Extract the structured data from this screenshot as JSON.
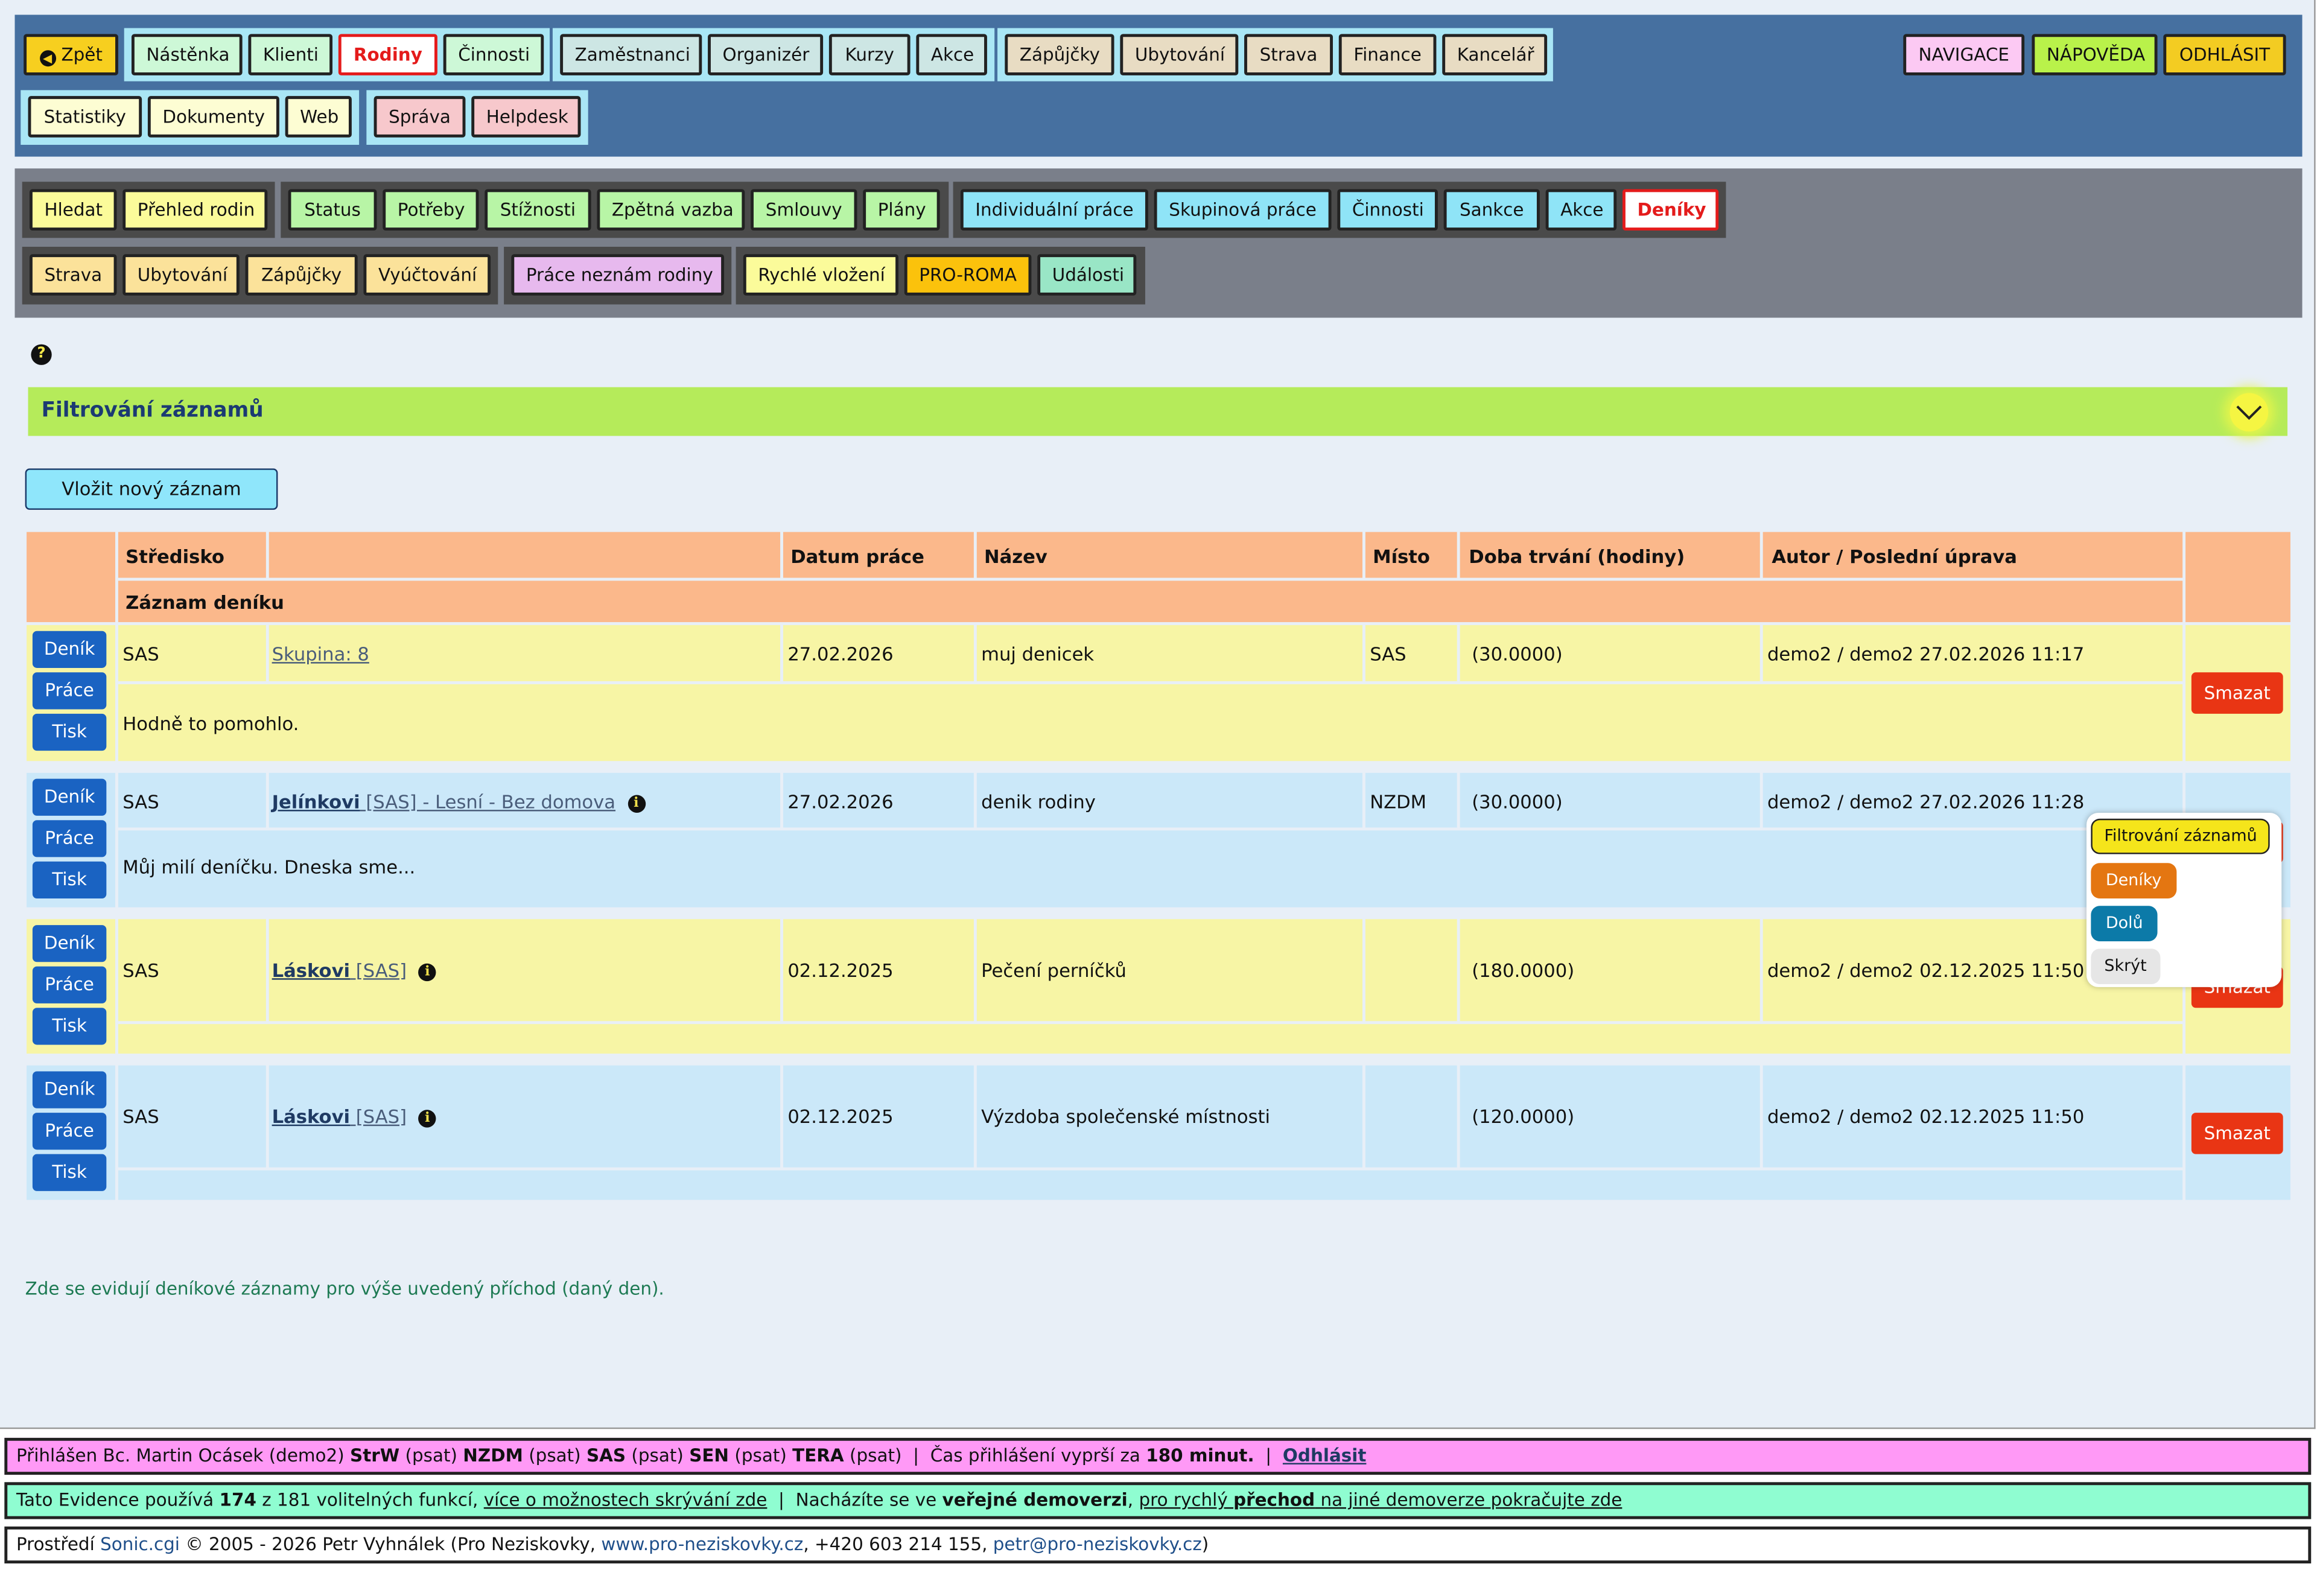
{
  "topnav": {
    "back": "Zpět",
    "group1": [
      "Nástěnka",
      "Klienti",
      "Rodiny",
      "Činnosti"
    ],
    "group2": [
      "Zaměstnanci",
      "Organizér",
      "Kurzy",
      "Akce"
    ],
    "group3": [
      "Zápůjčky",
      "Ubytování",
      "Strava",
      "Finance",
      "Kancelář"
    ],
    "group4": [
      "Statistiky",
      "Dokumenty",
      "Web"
    ],
    "group5": [
      "Správa",
      "Helpdesk"
    ],
    "right": [
      "NAVIGACE",
      "NÁPOVĚDA",
      "ODHLÁSIT"
    ]
  },
  "secnav": {
    "g1": [
      "Hledat",
      "Přehled rodin"
    ],
    "g2": [
      "Status",
      "Potřeby",
      "Stížnosti",
      "Zpětná vazba",
      "Smlouvy",
      "Plány"
    ],
    "g3": [
      "Individuální práce",
      "Skupinová práce",
      "Činnosti",
      "Sankce",
      "Akce",
      "Deníky"
    ],
    "g4": [
      "Strava",
      "Ubytování",
      "Zápůjčky",
      "Vyúčtování"
    ],
    "g5": [
      "Práce neznám rodiny"
    ],
    "g6": [
      "Rychlé vložení",
      "PRO-ROMA",
      "Události"
    ]
  },
  "help_icon": "?",
  "filter": {
    "title": "Filtrování záznamů"
  },
  "insert_button": "Vložit nový záznam",
  "table": {
    "headers": [
      "Středisko",
      "",
      "Datum práce",
      "Název",
      "Místo",
      "Doba trvání (hodiny)",
      "Autor / Poslední úprava"
    ],
    "subheader": "Záznam deníku",
    "row_buttons": [
      "Deník",
      "Práce",
      "Tisk"
    ],
    "delete_label": "Smazat",
    "rows": [
      {
        "stredisko": "SAS",
        "link_bold": "",
        "link_rest": "Skupina: 8",
        "info": false,
        "datum": "27.02.2026",
        "nazev": "muj denicek",
        "misto": "SAS",
        "doba": "(30.0000)",
        "autor": "demo2 / demo2 27.02.2026 11:17",
        "zaznam": "Hodně to pomohlo."
      },
      {
        "stredisko": "SAS",
        "link_bold": "Jelínkovi",
        "link_rest": " [SAS] - Lesní - Bez domova",
        "info": true,
        "datum": "27.02.2026",
        "nazev": "denik rodiny",
        "misto": "NZDM",
        "doba": "(30.0000)",
        "autor": "demo2 / demo2 27.02.2026 11:28",
        "zaznam": "Můj milí deníčku. Dneska sme..."
      },
      {
        "stredisko": "SAS",
        "link_bold": "Láskovi",
        "link_rest": " [SAS]",
        "info": true,
        "datum": "02.12.2025",
        "nazev": "Pečení perníčků",
        "misto": "",
        "doba": "(180.0000)",
        "autor": "demo2 / demo2 02.12.2025 11:50",
        "zaznam": ""
      },
      {
        "stredisko": "SAS",
        "link_bold": "Láskovi",
        "link_rest": " [SAS]",
        "info": true,
        "datum": "02.12.2025",
        "nazev": "Výzdoba společenské místnosti",
        "misto": "",
        "doba": "(120.0000)",
        "autor": "demo2 / demo2 02.12.2025 11:50",
        "zaznam": ""
      }
    ]
  },
  "popup": {
    "items": [
      "Filtrování záznamů",
      "Deníky",
      "Dolů",
      "Skrýt"
    ]
  },
  "note": "Zde se evidují deníkové záznamy pro výše uvedený příchod (daný den).",
  "footer": {
    "line1": {
      "prefix": "Přihlášen Bc. Martin Ocásek (demo2) ",
      "roles": [
        {
          "code": "StrW",
          "note": " (psat) "
        },
        {
          "code": "NZDM",
          "note": " (psat) "
        },
        {
          "code": "SAS",
          "note": " (psat) "
        },
        {
          "code": "SEN",
          "note": " (psat) "
        },
        {
          "code": "TERA",
          "note": " (psat)"
        }
      ],
      "sep1": "  |  Čas přihlášení vyprší za ",
      "time": "180 minut.",
      "sep2": "  |  ",
      "logout": "Odhlásit"
    },
    "line2": {
      "p1": "Tato Evidence používá ",
      "used": "174",
      "p2": " z 181 volitelných funkcí, ",
      "link1": "více o možnostech skrývání zde",
      "p3": "  |  Nacházíte se ve ",
      "bold1": "veřejné demoverzi",
      "p4": ", ",
      "link2a": "pro rychlý ",
      "link2b": "přechod",
      "link2c": " na jiné demoverze pokračujte zde"
    },
    "line3": {
      "p1": "Prostředí ",
      "sonic": "Sonic.cgi",
      "p2": " © 2005 - 2026 Petr Vyhnálek (Pro Neziskovky, ",
      "web": "www.pro-neziskovky.cz",
      "p3": ", +420 603 214 155, ",
      "mail": "petr@pro-neziskovky.cz",
      "p4": ")"
    }
  },
  "colors": {
    "accent_red": "#e41b1b",
    "filter_bar": "#b5eb5a",
    "table_header": "#fbb88b",
    "button_blue": "#1a63c2",
    "delete_red": "#e93514"
  }
}
